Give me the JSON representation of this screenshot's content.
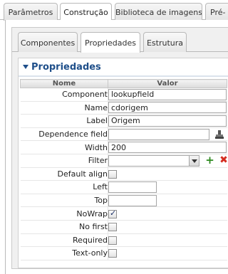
{
  "top_tabs": [
    {
      "label": "Parâmetros",
      "active": false
    },
    {
      "label": "Construção",
      "active": true
    },
    {
      "label": "Biblioteca de imagens",
      "active": false
    },
    {
      "label": "Pré-",
      "active": false
    }
  ],
  "sub_tabs": [
    {
      "label": "Componentes",
      "active": false
    },
    {
      "label": "Propriedades",
      "active": true
    },
    {
      "label": "Estrutura",
      "active": false
    }
  ],
  "properties_panel": {
    "title": "Propriedades",
    "columns": {
      "name": "Nome",
      "value": "Valor"
    },
    "rows": {
      "component": {
        "label": "Component",
        "value": "lookupfield"
      },
      "name": {
        "label": "Name",
        "value": "cdorigem"
      },
      "label": {
        "label": "Label",
        "value": "Origem"
      },
      "dependence_field": {
        "label": "Dependence field",
        "value": ""
      },
      "width": {
        "label": "Width",
        "value": "200"
      },
      "filter": {
        "label": "Filter",
        "value": ""
      },
      "default_align": {
        "label": "Default align",
        "checked": false
      },
      "left": {
        "label": "Left",
        "value": ""
      },
      "top": {
        "label": "Top",
        "value": ""
      },
      "nowrap": {
        "label": "NoWrap",
        "checked": true
      },
      "no_first": {
        "label": "No first",
        "checked": false
      },
      "required": {
        "label": "Required",
        "checked": false
      },
      "text_only": {
        "label": "Text-only",
        "checked": false
      }
    }
  },
  "colors": {
    "accent": "#1f4f8a",
    "add": "#2c8a1e",
    "delete": "#d42b1e"
  }
}
